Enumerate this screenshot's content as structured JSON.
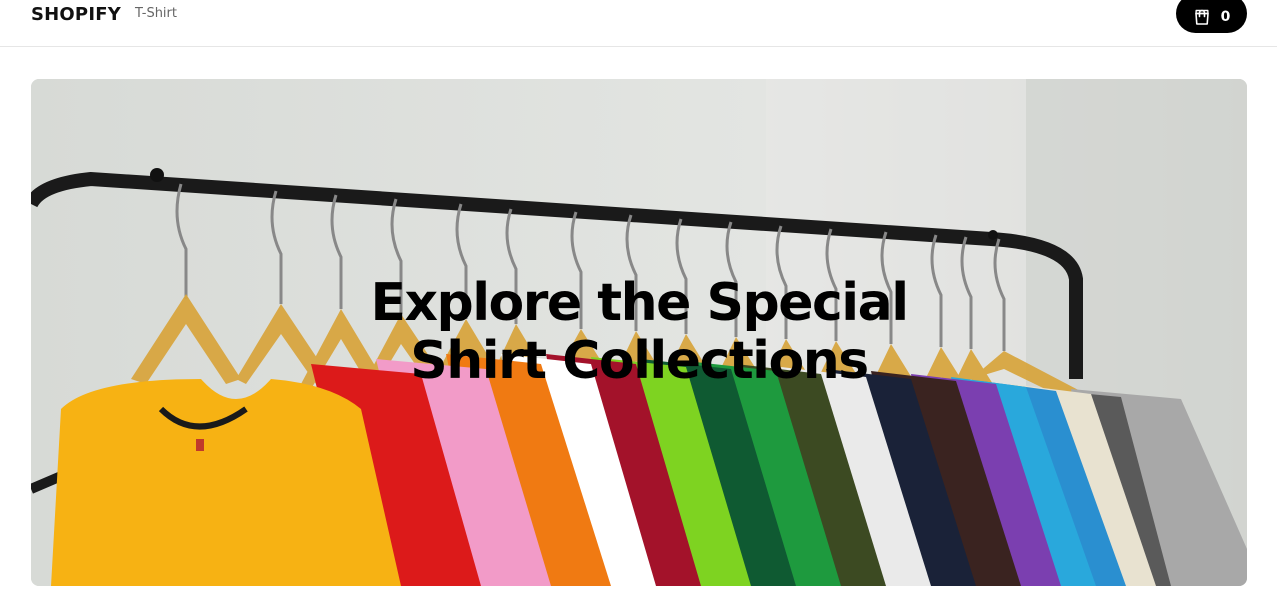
{
  "header": {
    "brand": "SHOPIFY",
    "nav_link": "T-Shirt",
    "cart": {
      "icon": "shopping-bag-icon",
      "count": "0"
    }
  },
  "hero": {
    "title_line1": "Explore the Special",
    "title_line2": "Shirt Collections",
    "image": "clothes-rack-with-colorful-t-shirts"
  },
  "colors": {
    "cart_background": "#000000",
    "header_border": "#e6e6e6",
    "nav_text": "#666666"
  }
}
